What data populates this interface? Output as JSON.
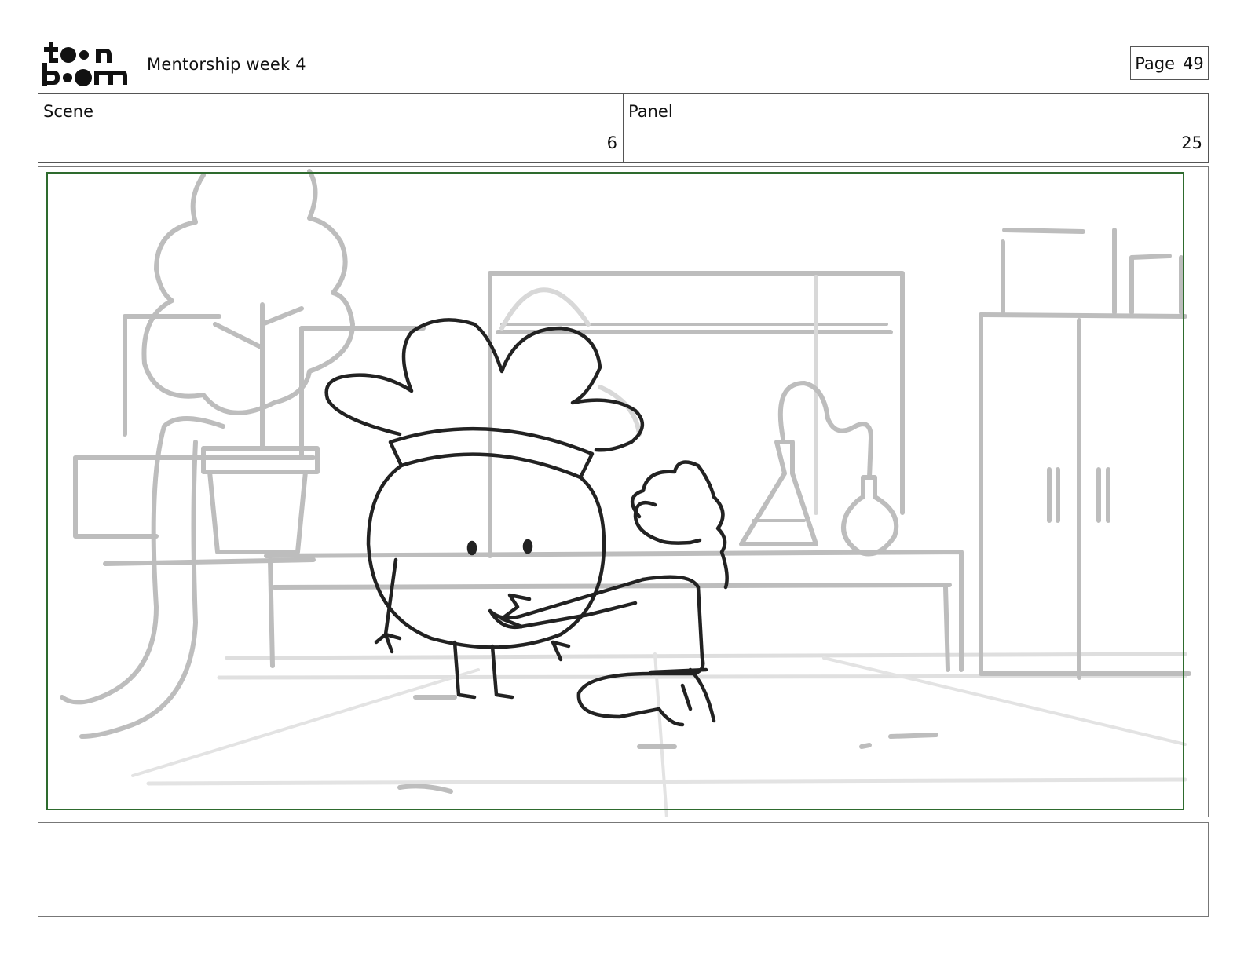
{
  "header": {
    "logo_top": "t●●n",
    "logo_bottom": "b●●m",
    "title": "Mentorship week 4",
    "page_label": "Page",
    "page_number": "49"
  },
  "info": {
    "scene_label": "Scene",
    "scene_value": "6",
    "panel_label": "Panel",
    "panel_value": "25"
  },
  "panel": {
    "safe_frame_color": "#2e6b2e"
  },
  "caption": {
    "text": ""
  }
}
